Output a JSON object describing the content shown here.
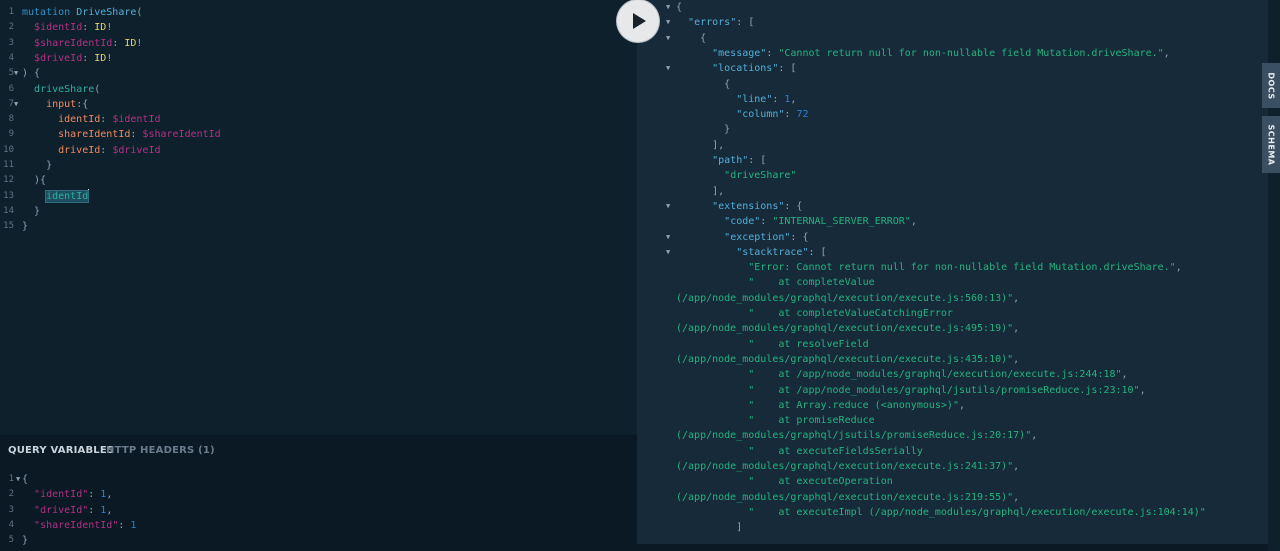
{
  "run_button": {
    "icon": "play-icon"
  },
  "editor": {
    "lines": [
      {
        "n": "1",
        "fold": false,
        "tokens": [
          {
            "t": "mutation ",
            "c": "k"
          },
          {
            "t": "DriveShare",
            "c": "def"
          },
          {
            "t": "(",
            "c": "punc"
          }
        ]
      },
      {
        "n": "2",
        "fold": false,
        "tokens": [
          {
            "t": "  ",
            "c": "punc"
          },
          {
            "t": "$identId",
            "c": "var"
          },
          {
            "t": ": ",
            "c": "punc"
          },
          {
            "t": "ID",
            "c": "type"
          },
          {
            "t": "!",
            "c": "punc"
          }
        ]
      },
      {
        "n": "3",
        "fold": false,
        "tokens": [
          {
            "t": "  ",
            "c": "punc"
          },
          {
            "t": "$shareIdentId",
            "c": "var"
          },
          {
            "t": ": ",
            "c": "punc"
          },
          {
            "t": "ID",
            "c": "type"
          },
          {
            "t": "!",
            "c": "punc"
          }
        ]
      },
      {
        "n": "4",
        "fold": false,
        "tokens": [
          {
            "t": "  ",
            "c": "punc"
          },
          {
            "t": "$driveId",
            "c": "var"
          },
          {
            "t": ": ",
            "c": "punc"
          },
          {
            "t": "ID",
            "c": "type"
          },
          {
            "t": "!",
            "c": "punc"
          }
        ]
      },
      {
        "n": "5",
        "fold": true,
        "tokens": [
          {
            "t": ") {",
            "c": "punc"
          }
        ]
      },
      {
        "n": "6",
        "fold": false,
        "tokens": [
          {
            "t": "  ",
            "c": "punc"
          },
          {
            "t": "driveShare",
            "c": "fld"
          },
          {
            "t": "(",
            "c": "punc"
          }
        ]
      },
      {
        "n": "7",
        "fold": true,
        "tokens": [
          {
            "t": "    ",
            "c": "punc"
          },
          {
            "t": "input",
            "c": "attr"
          },
          {
            "t": ":{",
            "c": "punc"
          }
        ]
      },
      {
        "n": "8",
        "fold": false,
        "tokens": [
          {
            "t": "      ",
            "c": "punc"
          },
          {
            "t": "identId",
            "c": "attr"
          },
          {
            "t": ": ",
            "c": "punc"
          },
          {
            "t": "$identId",
            "c": "var"
          }
        ]
      },
      {
        "n": "9",
        "fold": false,
        "tokens": [
          {
            "t": "      ",
            "c": "punc"
          },
          {
            "t": "shareIdentId",
            "c": "attr"
          },
          {
            "t": ": ",
            "c": "punc"
          },
          {
            "t": "$shareIdentId",
            "c": "var"
          }
        ]
      },
      {
        "n": "10",
        "fold": false,
        "tokens": [
          {
            "t": "      ",
            "c": "punc"
          },
          {
            "t": "driveId",
            "c": "attr"
          },
          {
            "t": ": ",
            "c": "punc"
          },
          {
            "t": "$driveId",
            "c": "var"
          }
        ]
      },
      {
        "n": "11",
        "fold": false,
        "tokens": [
          {
            "t": "    }",
            "c": "punc"
          }
        ]
      },
      {
        "n": "12",
        "fold": false,
        "tokens": [
          {
            "t": "  ){",
            "c": "punc"
          }
        ]
      },
      {
        "n": "13",
        "fold": false,
        "tokens": [
          {
            "t": "    ",
            "c": "punc"
          },
          {
            "t": "identId",
            "c": "fld",
            "sel": true
          }
        ]
      },
      {
        "n": "14",
        "fold": false,
        "tokens": [
          {
            "t": "  }",
            "c": "punc"
          }
        ]
      },
      {
        "n": "15",
        "fold": false,
        "tokens": [
          {
            "t": "}",
            "c": "punc"
          }
        ]
      }
    ]
  },
  "variables_panel": {
    "tab_query_variables": "QUERY VARIABLES",
    "tab_http_headers": "HTTP HEADERS (1)",
    "lines": [
      {
        "n": "1",
        "fold": true,
        "tokens": [
          {
            "t": "{",
            "c": "punc"
          }
        ]
      },
      {
        "n": "2",
        "fold": false,
        "tokens": [
          {
            "t": "  ",
            "c": "punc"
          },
          {
            "t": "\"identId\"",
            "c": "key"
          },
          {
            "t": ": ",
            "c": "punc"
          },
          {
            "t": "1",
            "c": "num"
          },
          {
            "t": ",",
            "c": "punc"
          }
        ]
      },
      {
        "n": "3",
        "fold": false,
        "tokens": [
          {
            "t": "  ",
            "c": "punc"
          },
          {
            "t": "\"driveId\"",
            "c": "key"
          },
          {
            "t": ": ",
            "c": "punc"
          },
          {
            "t": "1",
            "c": "num"
          },
          {
            "t": ",",
            "c": "punc"
          }
        ]
      },
      {
        "n": "4",
        "fold": false,
        "tokens": [
          {
            "t": "  ",
            "c": "punc"
          },
          {
            "t": "\"shareIdentId\"",
            "c": "key"
          },
          {
            "t": ": ",
            "c": "punc"
          },
          {
            "t": "1",
            "c": "num"
          }
        ]
      },
      {
        "n": "5",
        "fold": false,
        "tokens": [
          {
            "t": "}",
            "c": "punc"
          }
        ]
      }
    ]
  },
  "results": {
    "lines": [
      {
        "fold": true,
        "tokens": [
          {
            "t": "{",
            "c": "punc"
          }
        ]
      },
      {
        "fold": true,
        "tokens": [
          {
            "t": "  ",
            "c": "punc"
          },
          {
            "t": "\"errors\"",
            "c": "rk"
          },
          {
            "t": ": [",
            "c": "punc"
          }
        ]
      },
      {
        "fold": true,
        "tokens": [
          {
            "t": "    {",
            "c": "punc"
          }
        ]
      },
      {
        "fold": false,
        "tokens": [
          {
            "t": "      ",
            "c": "punc"
          },
          {
            "t": "\"message\"",
            "c": "rk"
          },
          {
            "t": ": ",
            "c": "punc"
          },
          {
            "t": "\"Cannot return null for non-nullable field Mutation.driveShare.\"",
            "c": "str"
          },
          {
            "t": ",",
            "c": "punc"
          }
        ]
      },
      {
        "fold": true,
        "tokens": [
          {
            "t": "      ",
            "c": "punc"
          },
          {
            "t": "\"locations\"",
            "c": "rk"
          },
          {
            "t": ": [",
            "c": "punc"
          }
        ]
      },
      {
        "fold": false,
        "tokens": [
          {
            "t": "        {",
            "c": "punc"
          }
        ]
      },
      {
        "fold": false,
        "tokens": [
          {
            "t": "          ",
            "c": "punc"
          },
          {
            "t": "\"line\"",
            "c": "rk"
          },
          {
            "t": ": ",
            "c": "punc"
          },
          {
            "t": "1",
            "c": "rn"
          },
          {
            "t": ",",
            "c": "punc"
          }
        ]
      },
      {
        "fold": false,
        "tokens": [
          {
            "t": "          ",
            "c": "punc"
          },
          {
            "t": "\"column\"",
            "c": "rk"
          },
          {
            "t": ": ",
            "c": "punc"
          },
          {
            "t": "72",
            "c": "rn"
          }
        ]
      },
      {
        "fold": false,
        "tokens": [
          {
            "t": "        }",
            "c": "punc"
          }
        ]
      },
      {
        "fold": false,
        "tokens": [
          {
            "t": "      ],",
            "c": "punc"
          }
        ]
      },
      {
        "fold": false,
        "tokens": [
          {
            "t": "      ",
            "c": "punc"
          },
          {
            "t": "\"path\"",
            "c": "rk"
          },
          {
            "t": ": [",
            "c": "punc"
          }
        ]
      },
      {
        "fold": false,
        "tokens": [
          {
            "t": "        ",
            "c": "punc"
          },
          {
            "t": "\"driveShare\"",
            "c": "str"
          }
        ]
      },
      {
        "fold": false,
        "tokens": [
          {
            "t": "      ],",
            "c": "punc"
          }
        ]
      },
      {
        "fold": true,
        "tokens": [
          {
            "t": "      ",
            "c": "punc"
          },
          {
            "t": "\"extensions\"",
            "c": "rk"
          },
          {
            "t": ": {",
            "c": "punc"
          }
        ]
      },
      {
        "fold": false,
        "tokens": [
          {
            "t": "        ",
            "c": "punc"
          },
          {
            "t": "\"code\"",
            "c": "rk"
          },
          {
            "t": ": ",
            "c": "punc"
          },
          {
            "t": "\"INTERNAL_SERVER_ERROR\"",
            "c": "str"
          },
          {
            "t": ",",
            "c": "punc"
          }
        ]
      },
      {
        "fold": true,
        "tokens": [
          {
            "t": "        ",
            "c": "punc"
          },
          {
            "t": "\"exception\"",
            "c": "rk"
          },
          {
            "t": ": {",
            "c": "punc"
          }
        ]
      },
      {
        "fold": true,
        "tokens": [
          {
            "t": "          ",
            "c": "punc"
          },
          {
            "t": "\"stacktrace\"",
            "c": "rk"
          },
          {
            "t": ": [",
            "c": "punc"
          }
        ]
      },
      {
        "fold": false,
        "tokens": [
          {
            "t": "            ",
            "c": "punc"
          },
          {
            "t": "\"Error: Cannot return null for non-nullable field Mutation.driveShare.\"",
            "c": "str"
          },
          {
            "t": ",",
            "c": "punc"
          }
        ]
      },
      {
        "fold": false,
        "tokens": [
          {
            "t": "            ",
            "c": "punc"
          },
          {
            "t": "\"    at completeValue",
            "c": "str"
          }
        ]
      },
      {
        "fold": false,
        "tokens": [
          {
            "t": "(/app/node_modules/graphql/execution/execute.js:560:13)\"",
            "c": "str"
          },
          {
            "t": ",",
            "c": "punc"
          }
        ]
      },
      {
        "fold": false,
        "tokens": [
          {
            "t": "            ",
            "c": "punc"
          },
          {
            "t": "\"    at completeValueCatchingError",
            "c": "str"
          }
        ]
      },
      {
        "fold": false,
        "tokens": [
          {
            "t": "(/app/node_modules/graphql/execution/execute.js:495:19)\"",
            "c": "str"
          },
          {
            "t": ",",
            "c": "punc"
          }
        ]
      },
      {
        "fold": false,
        "tokens": [
          {
            "t": "            ",
            "c": "punc"
          },
          {
            "t": "\"    at resolveField",
            "c": "str"
          }
        ]
      },
      {
        "fold": false,
        "tokens": [
          {
            "t": "(/app/node_modules/graphql/execution/execute.js:435:10)\"",
            "c": "str"
          },
          {
            "t": ",",
            "c": "punc"
          }
        ]
      },
      {
        "fold": false,
        "tokens": [
          {
            "t": "            ",
            "c": "punc"
          },
          {
            "t": "\"    at /app/node_modules/graphql/execution/execute.js:244:18\"",
            "c": "str"
          },
          {
            "t": ",",
            "c": "punc"
          }
        ]
      },
      {
        "fold": false,
        "tokens": [
          {
            "t": "            ",
            "c": "punc"
          },
          {
            "t": "\"    at /app/node_modules/graphql/jsutils/promiseReduce.js:23:10\"",
            "c": "str"
          },
          {
            "t": ",",
            "c": "punc"
          }
        ]
      },
      {
        "fold": false,
        "tokens": [
          {
            "t": "            ",
            "c": "punc"
          },
          {
            "t": "\"    at Array.reduce (<anonymous>)\"",
            "c": "str"
          },
          {
            "t": ",",
            "c": "punc"
          }
        ]
      },
      {
        "fold": false,
        "tokens": [
          {
            "t": "            ",
            "c": "punc"
          },
          {
            "t": "\"    at promiseReduce",
            "c": "str"
          }
        ]
      },
      {
        "fold": false,
        "tokens": [
          {
            "t": "(/app/node_modules/graphql/jsutils/promiseReduce.js:20:17)\"",
            "c": "str"
          },
          {
            "t": ",",
            "c": "punc"
          }
        ]
      },
      {
        "fold": false,
        "tokens": [
          {
            "t": "            ",
            "c": "punc"
          },
          {
            "t": "\"    at executeFieldsSerially",
            "c": "str"
          }
        ]
      },
      {
        "fold": false,
        "tokens": [
          {
            "t": "(/app/node_modules/graphql/execution/execute.js:241:37)\"",
            "c": "str"
          },
          {
            "t": ",",
            "c": "punc"
          }
        ]
      },
      {
        "fold": false,
        "tokens": [
          {
            "t": "            ",
            "c": "punc"
          },
          {
            "t": "\"    at executeOperation",
            "c": "str"
          }
        ]
      },
      {
        "fold": false,
        "tokens": [
          {
            "t": "(/app/node_modules/graphql/execution/execute.js:219:55)\"",
            "c": "str"
          },
          {
            "t": ",",
            "c": "punc"
          }
        ]
      },
      {
        "fold": false,
        "tokens": [
          {
            "t": "            ",
            "c": "punc"
          },
          {
            "t": "\"    at executeImpl (/app/node_modules/graphql/execution/execute.js:104:14)\"",
            "c": "str"
          }
        ]
      },
      {
        "fold": false,
        "tokens": [
          {
            "t": "          ]",
            "c": "punc"
          }
        ]
      }
    ]
  },
  "side_tabs": {
    "docs": "DOCS",
    "schema": "SCHEMA"
  },
  "colors": {
    "editor_bg": "#0f202d",
    "results_bg": "#172a3a",
    "string": "#23b47c",
    "variable": "#b33086",
    "keyword": "#2f92c6"
  }
}
